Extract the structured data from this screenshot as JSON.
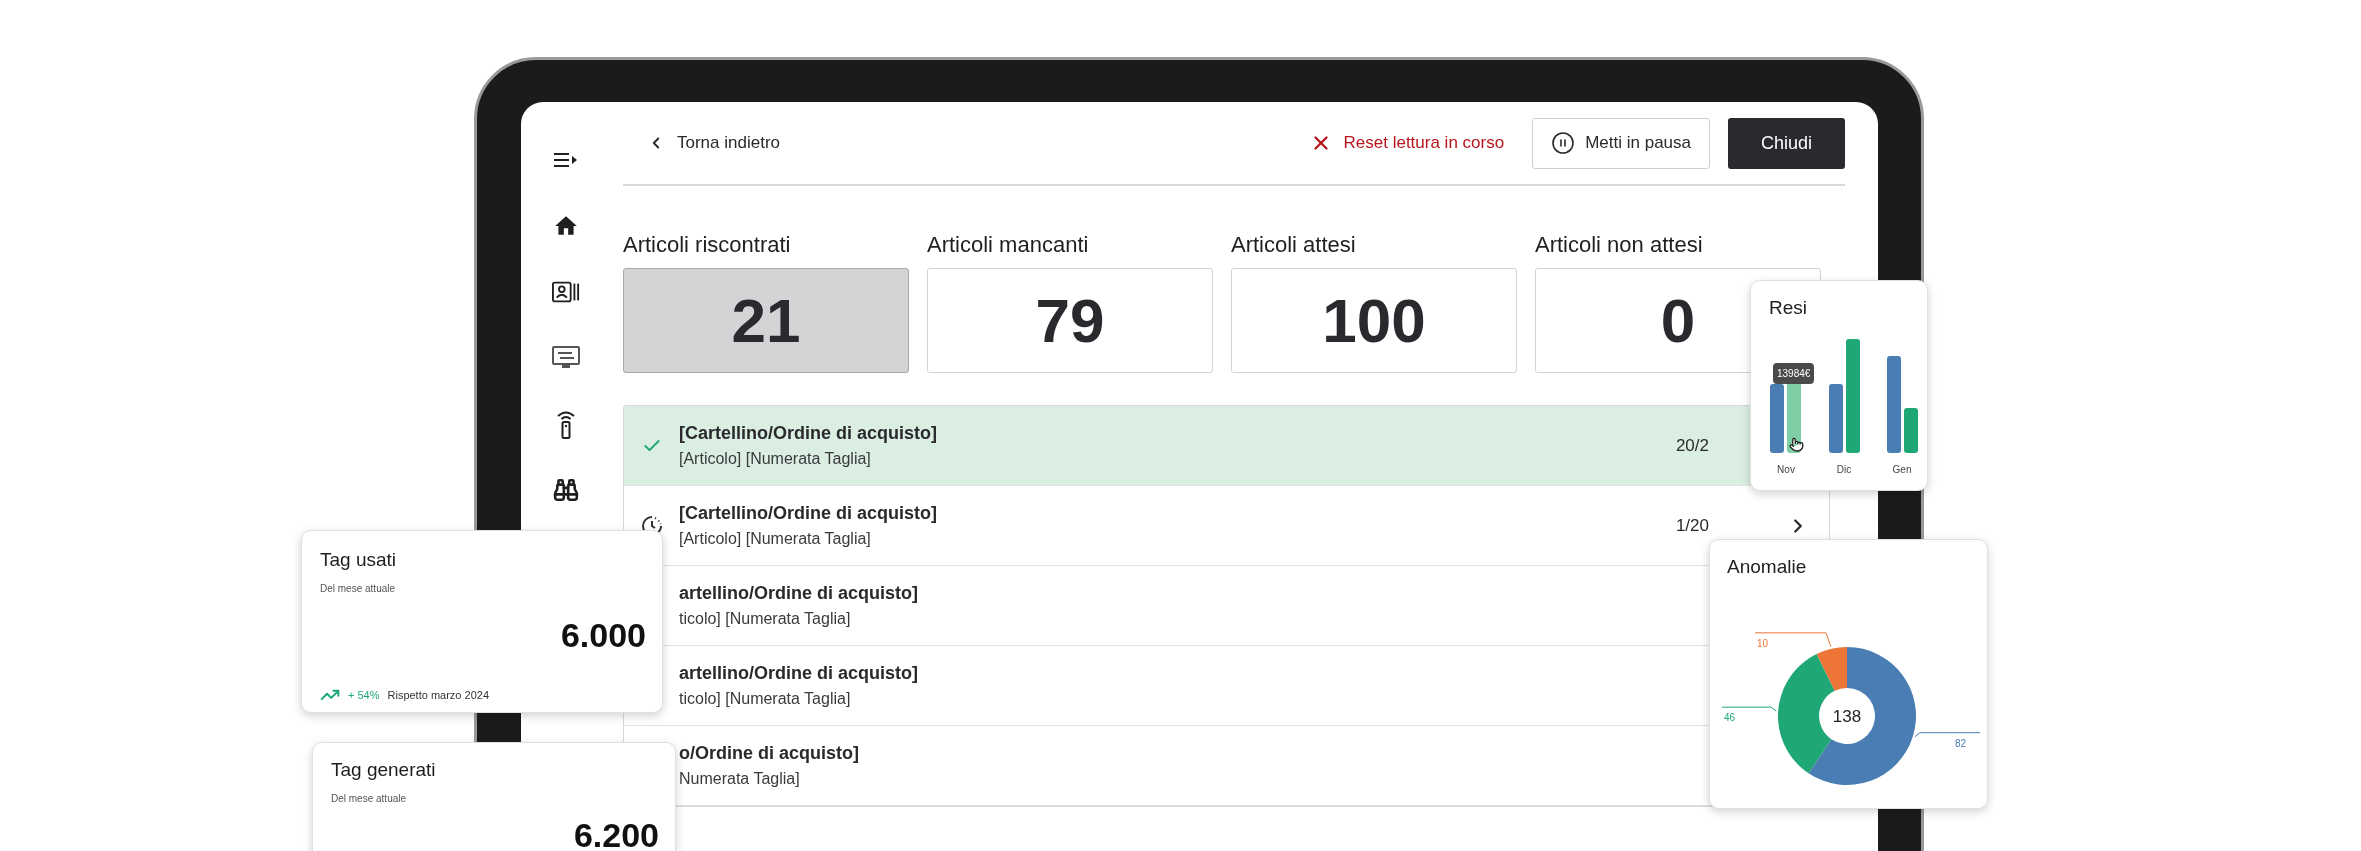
{
  "header": {
    "back": "Torna indietro",
    "reset": "Reset lettura in corso",
    "pause": "Metti in pausa",
    "close": "Chiudi"
  },
  "stats": [
    {
      "label": "Articoli riscontrati",
      "value": "21",
      "selected": true
    },
    {
      "label": "Articoli mancanti",
      "value": "79",
      "selected": false
    },
    {
      "label": "Articoli attesi",
      "value": "100",
      "selected": false
    },
    {
      "label": "Articoli non attesi",
      "value": "0",
      "selected": false
    }
  ],
  "rows": [
    {
      "kind": "done",
      "title": "[Cartellino/Ordine di acquisto]",
      "subtitle": "[Articolo] [Numerata Taglia]",
      "count": "20/2"
    },
    {
      "kind": "pending",
      "title": "[Cartellino/Ordine di acquisto]",
      "subtitle": "[Articolo] [Numerata Taglia]",
      "count": "1/20",
      "chevron": true
    },
    {
      "kind": "covered",
      "title": "artellino/Ordine di acquisto]",
      "subtitle": "ticolo] [Numerata Taglia]"
    },
    {
      "kind": "covered",
      "title": "artellino/Ordine di acquisto]",
      "subtitle": "ticolo] [Numerata Taglia]"
    },
    {
      "kind": "covered",
      "title": "o/Ordine di acquisto]",
      "subtitle": "Numerata Taglia]"
    }
  ],
  "resi": {
    "title": "Resi",
    "tooltip": "13984€",
    "categories": [
      "Nov",
      "Dic",
      "Gen"
    ]
  },
  "tag_usati": {
    "title": "Tag usati",
    "subtitle": "Del mese attuale",
    "value": "6.000",
    "trend": "+ 54%",
    "comparison": "Rispetto marzo 2024"
  },
  "tag_generati": {
    "title": "Tag generati",
    "subtitle": "Del mese attuale",
    "value": "6.200"
  },
  "anomalie": {
    "chart_data": {
      "type": "donut",
      "title": "Anomalie",
      "values": [
        82,
        46,
        10
      ],
      "colors": [
        "#4a7db3",
        "#1fa776",
        "#ee7538"
      ],
      "data_labels": true,
      "annotations": [
        {
          "text": "138"
        }
      ]
    }
  }
}
